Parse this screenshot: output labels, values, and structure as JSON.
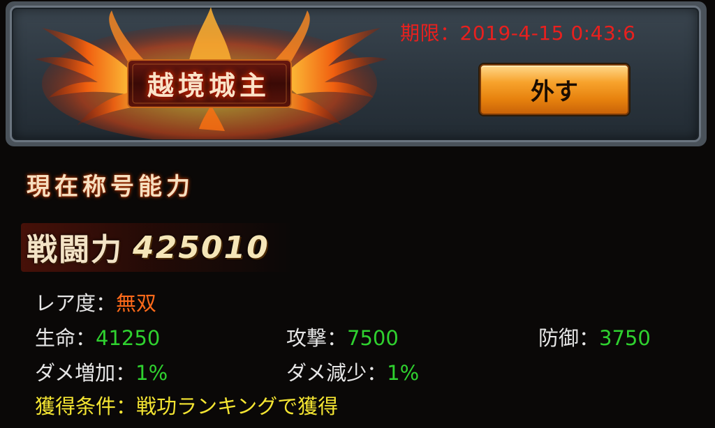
{
  "badge": {
    "title": "越境城主",
    "expiry_label": "期限：",
    "expiry_value": "2019-4-15 0:43:6",
    "unequip_label": "外す"
  },
  "ability": {
    "heading": "現在称号能力",
    "power_label": "戦闘力",
    "power_value": "425010"
  },
  "stats": {
    "rarity": {
      "label": "レア度：",
      "value": "無双"
    },
    "hp": {
      "label": "生命：",
      "value": "41250"
    },
    "attack": {
      "label": "攻撃：",
      "value": "7500"
    },
    "defense": {
      "label": "防御：",
      "value": "3750"
    },
    "damage_up": {
      "label": "ダメ増加：",
      "value": "1%"
    },
    "damage_down": {
      "label": "ダメ減少：",
      "value": "1%"
    },
    "condition": {
      "label": "獲得条件：",
      "value": "戦功ランキングで獲得"
    }
  },
  "colors": {
    "expiry": "#e8201e",
    "stat_value": "#2fd12f",
    "rarity_value": "#ff6a1a",
    "condition": "#f4e532",
    "button": "#e7820e"
  },
  "icons": {
    "emblem": "flaming-wings-emblem"
  }
}
